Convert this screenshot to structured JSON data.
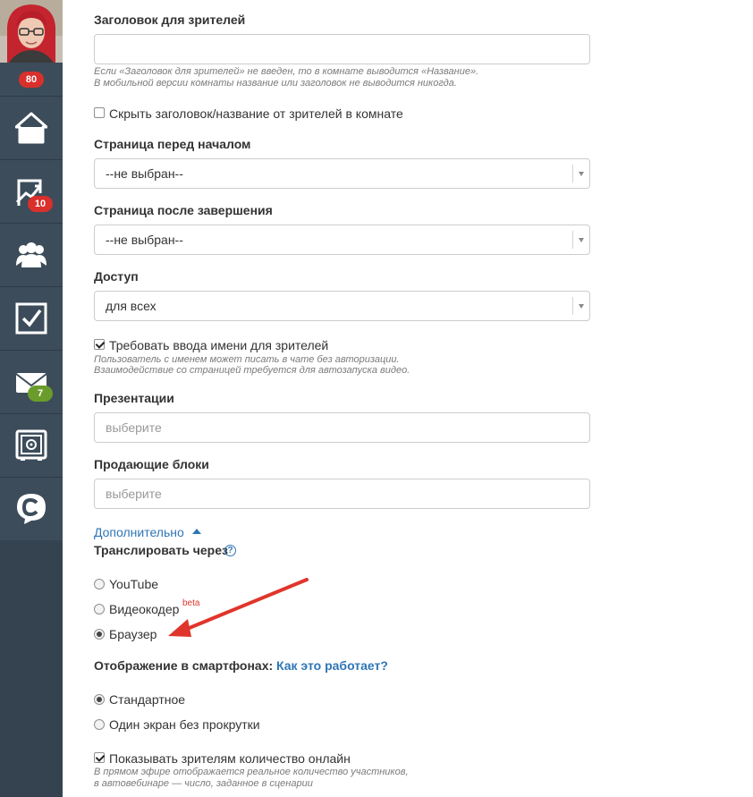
{
  "sidebar": {
    "avatar_badge": "80",
    "items": [
      {
        "name": "home",
        "badge": ""
      },
      {
        "name": "stats",
        "badge": "10"
      },
      {
        "name": "users",
        "badge": ""
      },
      {
        "name": "tasks",
        "badge": ""
      },
      {
        "name": "mail",
        "badge": "7"
      },
      {
        "name": "safe",
        "badge": ""
      },
      {
        "name": "brand",
        "badge": ""
      }
    ],
    "colors": {
      "bg": "#3c4c5a",
      "badge_red": "#d9302c",
      "badge_green": "#6a9c2b"
    }
  },
  "form": {
    "viewer_title": {
      "label": "Заголовок для зрителей",
      "value": "",
      "hint_line1": "Если «Заголовок для зрителей» не введен, то в комнате выводится «Название».",
      "hint_line2": "В мобильной версии комнаты название или заголовок не выводится никогда."
    },
    "hide_title": {
      "label": "Скрыть заголовок/название от зрителей в комнате",
      "checked": false
    },
    "page_before": {
      "label": "Страница перед началом",
      "value": "--не выбран--"
    },
    "page_after": {
      "label": "Страница после завершения",
      "value": "--не выбран--"
    },
    "access": {
      "label": "Доступ",
      "value": "для всех"
    },
    "require_name": {
      "label": "Требовать ввода имени для зрителей",
      "checked": true,
      "hint_line1": "Пользователь с именем может писать в чате без авторизации.",
      "hint_line2": "Взаимодействие со страницей требуется для автозапуска видео."
    },
    "presentations": {
      "label": "Презентации",
      "placeholder": "выберите"
    },
    "selling_blocks": {
      "label": "Продающие блоки",
      "placeholder": "выберите"
    },
    "advanced_toggle": "Дополнительно",
    "broadcast": {
      "label": "Транслировать через",
      "help": "?",
      "options": [
        {
          "label": "YouTube",
          "checked": false
        },
        {
          "label": "Видеокодер",
          "checked": false,
          "tag": "beta"
        },
        {
          "label": "Браузер",
          "checked": true
        }
      ]
    },
    "mobile_display": {
      "label": "Отображение в смартфонах:",
      "link": "Как это работает?",
      "options": [
        {
          "label": "Стандартное",
          "checked": true
        },
        {
          "label": "Один экран без прокрутки",
          "checked": false
        }
      ]
    },
    "show_online": {
      "label": "Показывать зрителям количество онлайн",
      "checked": true,
      "hint_line1": "В прямом эфире отображается реальное количество участников,",
      "hint_line2": "в автовебинаре — число, заданное в сценарии"
    },
    "colors": {
      "link": "#2f76b5",
      "arrow": "#e0352b"
    }
  }
}
